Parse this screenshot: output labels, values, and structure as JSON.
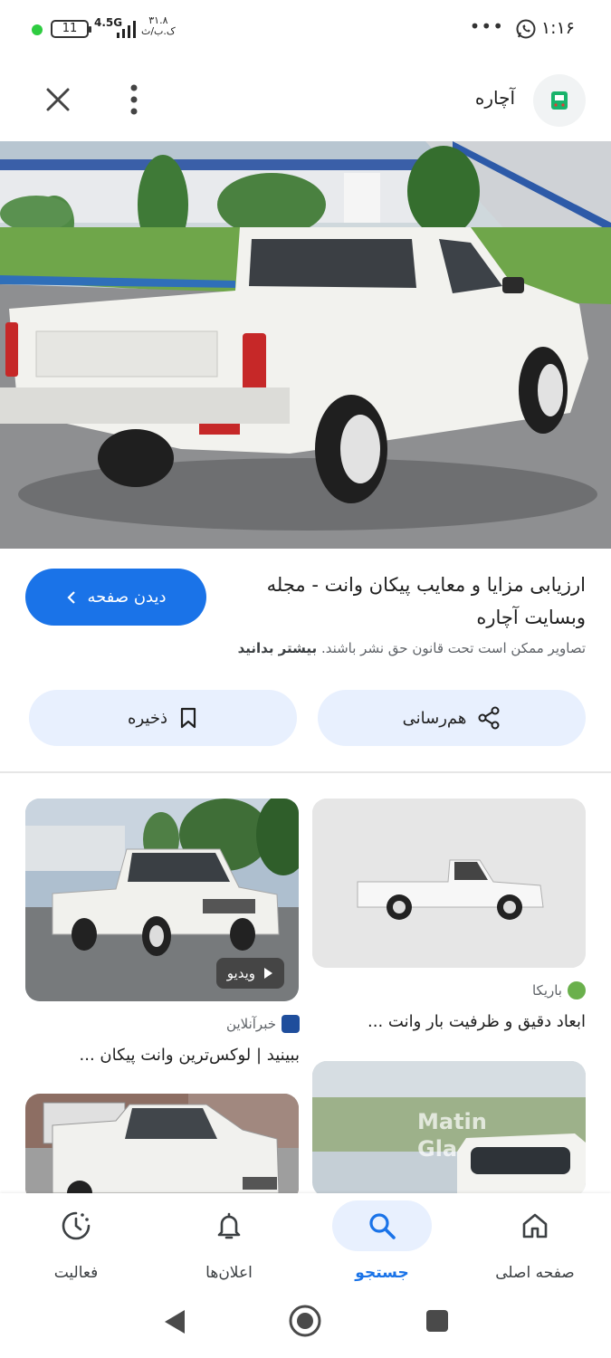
{
  "status_bar": {
    "time": "۱:۱۶",
    "battery": "11",
    "network": "4.5G",
    "speed_value": "۳۱.۸",
    "speed_unit": "ک.ب/ث",
    "more": "•••"
  },
  "header": {
    "site_name": "آچاره"
  },
  "detail": {
    "title": "ارزیابی مزایا و معایب پیکان وانت - مجله وبسایت آچاره",
    "visit_label": "دیدن صفحه",
    "copyright_text": "تصاویر ممکن است تحت قانون حق نشر باشند.",
    "learn_more": "بیشتر بدانید",
    "share_label": "هم‌رسانی",
    "save_label": "ذخیره"
  },
  "results": [
    {
      "source": "باریکا",
      "title": "ابعاد دقیق و ظرفیت بار وانت ..."
    },
    {
      "source": "خبرآنلاین",
      "title": "ببینید | لوکس‌ترین وانت پیکان ...",
      "badge": "ویدیو"
    },
    {
      "source": "",
      "title": "",
      "watermark_1": "Matin",
      "watermark_2": "Gla"
    }
  ],
  "bottom_nav": {
    "items": [
      {
        "label": "صفحه اصلی",
        "icon": "home-icon"
      },
      {
        "label": "جستجو",
        "icon": "search-icon",
        "active": true
      },
      {
        "label": "اعلان‌ها",
        "icon": "bell-icon"
      },
      {
        "label": "فعالیت",
        "icon": "activity-icon"
      }
    ]
  },
  "colors": {
    "accent": "#1a73e8",
    "chip_bg": "#e8f0fe"
  }
}
